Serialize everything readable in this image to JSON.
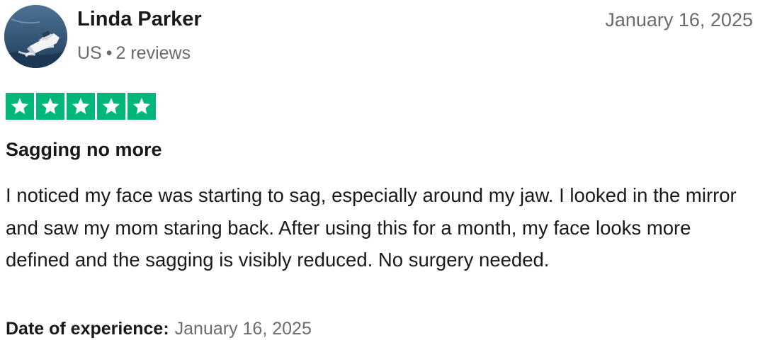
{
  "reviewer": {
    "name": "Linda Parker",
    "country": "US",
    "separator": "•",
    "review_count": "2 reviews",
    "avatar_icon": "boat-photo"
  },
  "review": {
    "date": "January 16, 2025",
    "rating": 5,
    "rating_max": 5,
    "star_color": "#00b67a",
    "title": "Sagging no more",
    "body": "I noticed my face was starting to sag, especially around my jaw. I looked in the mirror and saw my mom staring back. After using this for a month, my face looks more defined and the sagging is visibly reduced. No surgery needed.",
    "experience_label": "Date of experience:",
    "experience_date": "January 16, 2025"
  }
}
